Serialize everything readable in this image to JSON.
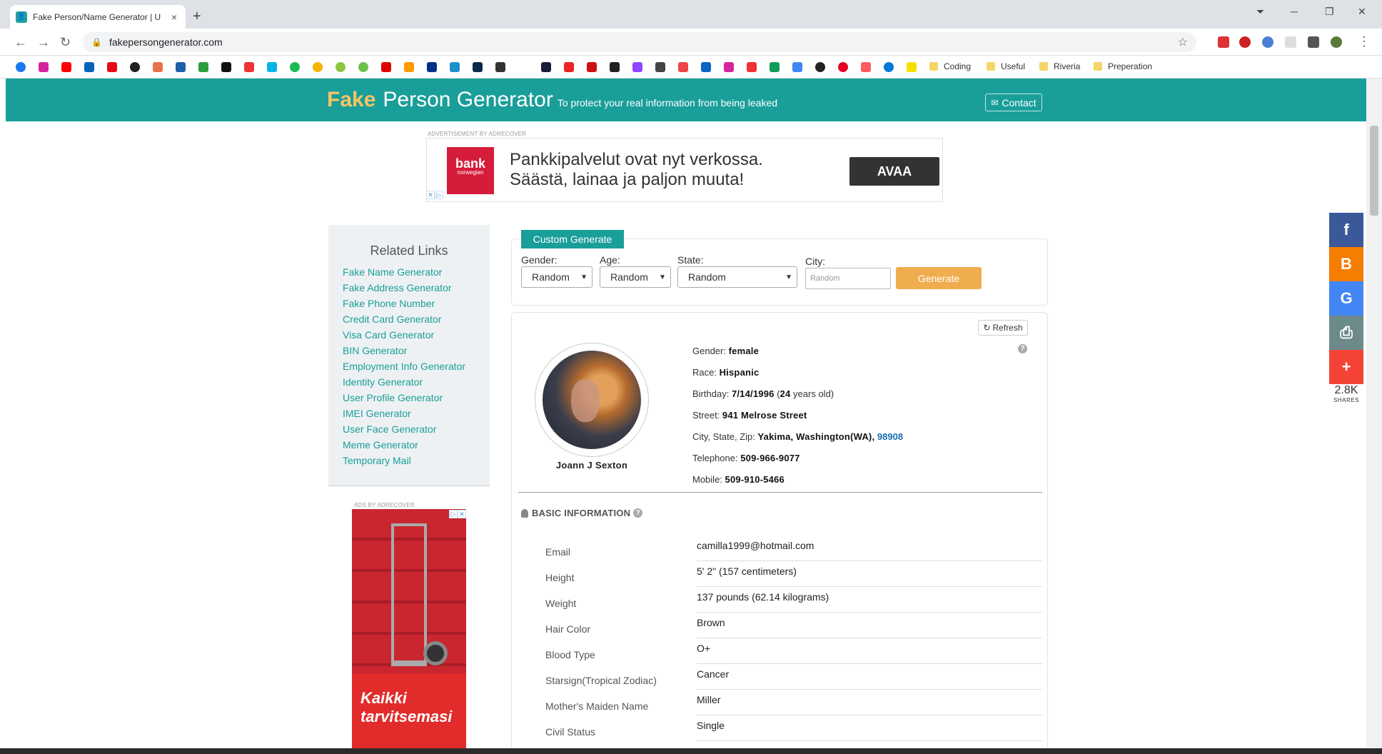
{
  "browser": {
    "tab_title": "Fake Person/Name Generator | U",
    "tab_close": "×",
    "new_tab": "+",
    "url": "fakepersongenerator.com",
    "bookmarks_folders": [
      "Coding",
      "Useful",
      "Riveria",
      "Preperation"
    ]
  },
  "header": {
    "logo_fake": "Fake",
    "logo_rest": "Person Generator",
    "tagline": "To protect your real information from being leaked",
    "contact_label": "Contact"
  },
  "top_ad": {
    "label": "ADVERTISEMENT BY ADRECOVER",
    "brand": "bank",
    "brand_sub": "norwegian",
    "line1": "Pankkipalvelut ovat nyt verkossa.",
    "line2": "Säästä, lainaa ja paljon muuta!",
    "button": "AVAA"
  },
  "related": {
    "title": "Related Links",
    "links": [
      "Fake Name Generator",
      "Fake Address Generator",
      "Fake Phone Number",
      "Credit Card Generator",
      "Visa Card Generator",
      "BIN Generator",
      "Employment Info Generator",
      "Identity Generator",
      "User Profile Generator",
      "IMEI Generator",
      "User Face Generator",
      "Meme Generator",
      "Temporary Mail"
    ]
  },
  "side_ad": {
    "label": "ADS BY ADRECOVER",
    "line1": "Kaikki",
    "line2": "tarvitsemasi"
  },
  "custom_generate": {
    "tab_label": "Custom Generate",
    "gender_label": "Gender:",
    "gender_value": "Random",
    "age_label": "Age:",
    "age_value": "Random",
    "state_label": "State:",
    "state_value": "Random",
    "city_label": "City:",
    "city_placeholder": "Random",
    "generate_label": "Generate"
  },
  "profile": {
    "refresh_label": "Refresh",
    "name": "Joann J Sexton",
    "gender_label": "Gender:",
    "gender": "female",
    "race_label": "Race:",
    "race": "Hispanic",
    "birthday_label": "Birthday:",
    "birthday": "7/14/1996",
    "birthday_age_open": "(",
    "birthday_age": "24",
    "birthday_age_close": "years old)",
    "street_label": "Street:",
    "street": "941 Melrose Street",
    "csz_label": "City, State, Zip:",
    "csz": "Yakima, Washington(WA),",
    "zip": "98908",
    "telephone_label": "Telephone:",
    "telephone": "509-966-9077",
    "mobile_label": "Mobile:",
    "mobile": "509-910-5466"
  },
  "basic_info": {
    "title": "BASIC INFORMATION",
    "rows": [
      {
        "k": "Email",
        "v": "camilla1999@hotmail.com"
      },
      {
        "k": "Height",
        "v": "5' 2\" (157 centimeters)"
      },
      {
        "k": "Weight",
        "v": "137 pounds (62.14 kilograms)"
      },
      {
        "k": "Hair Color",
        "v": "Brown"
      },
      {
        "k": "Blood Type",
        "v": "O+"
      },
      {
        "k": "Starsign(Tropical Zodiac)",
        "v": "Cancer"
      },
      {
        "k": "Mother's Maiden Name",
        "v": "Miller"
      },
      {
        "k": "Civil Status",
        "v": "Single"
      }
    ]
  },
  "share": {
    "count": "2.8K",
    "label": "SHARES",
    "colors": {
      "facebook": "#3b5998",
      "blogger": "#f57d00",
      "google": "#4285f4",
      "print": "#6d8a8b",
      "more": "#f44336"
    }
  }
}
